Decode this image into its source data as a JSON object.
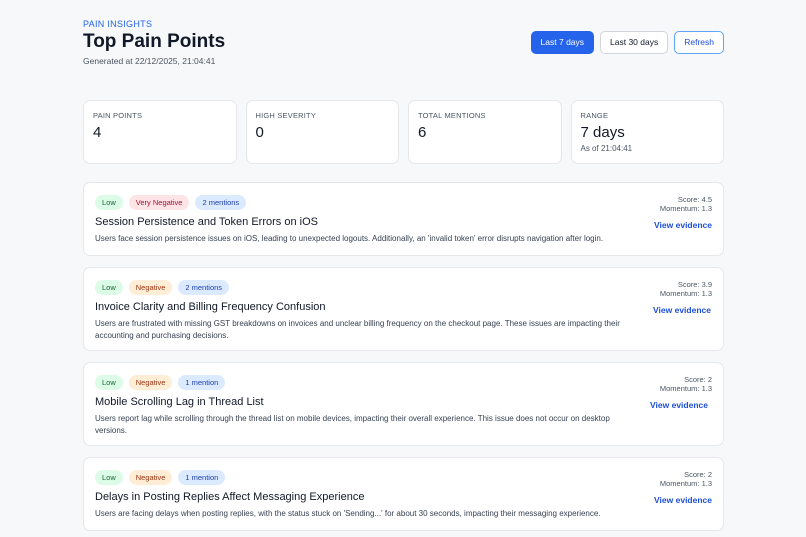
{
  "header": {
    "eyebrow": "PAIN INSIGHTS",
    "title": "Top Pain Points",
    "generated": "Generated at 22/12/2025, 21:04:41"
  },
  "range_buttons": {
    "last7": "Last 7 days",
    "last30": "Last 30 days",
    "refresh": "Refresh"
  },
  "stats": [
    {
      "label": "PAIN POINTS",
      "value": "4"
    },
    {
      "label": "HIGH SEVERITY",
      "value": "0"
    },
    {
      "label": "TOTAL MENTIONS",
      "value": "6"
    },
    {
      "label": "RANGE",
      "value": "7 days",
      "sub": "As of 21:04:41"
    }
  ],
  "pain_points": [
    {
      "severity": "Low",
      "sentiment": "Very Negative",
      "mentions": "2 mentions",
      "title": "Session Persistence and Token Errors on iOS",
      "description": "Users face session persistence issues on iOS, leading to unexpected logouts. Additionally, an 'invalid token' error disrupts navigation after login.",
      "score": "Score: 4.5",
      "momentum": "Momentum: 1.3",
      "evidence": "View evidence"
    },
    {
      "severity": "Low",
      "sentiment": "Negative",
      "mentions": "2 mentions",
      "title": "Invoice Clarity and Billing Frequency Confusion",
      "description": "Users are frustrated with missing GST breakdowns on invoices and unclear billing frequency on the checkout page. These issues are impacting their accounting and purchasing decisions.",
      "score": "Score: 3.9",
      "momentum": "Momentum: 1.3",
      "evidence": "View evidence"
    },
    {
      "severity": "Low",
      "sentiment": "Negative",
      "mentions": "1 mention",
      "title": "Mobile Scrolling Lag in Thread List",
      "description": "Users report lag while scrolling through the thread list on mobile devices, impacting their overall experience. This issue does not occur on desktop versions.",
      "score": "Score: 2",
      "momentum": "Momentum: 1.3",
      "evidence": "View evidence"
    },
    {
      "severity": "Low",
      "sentiment": "Negative",
      "mentions": "1 mention",
      "title": "Delays in Posting Replies Affect Messaging Experience",
      "description": "Users are facing delays when posting replies, with the status stuck on 'Sending...' for about 30 seconds, impacting their messaging experience.",
      "score": "Score: 2",
      "momentum": "Momentum: 1.3",
      "evidence": "View evidence"
    }
  ]
}
